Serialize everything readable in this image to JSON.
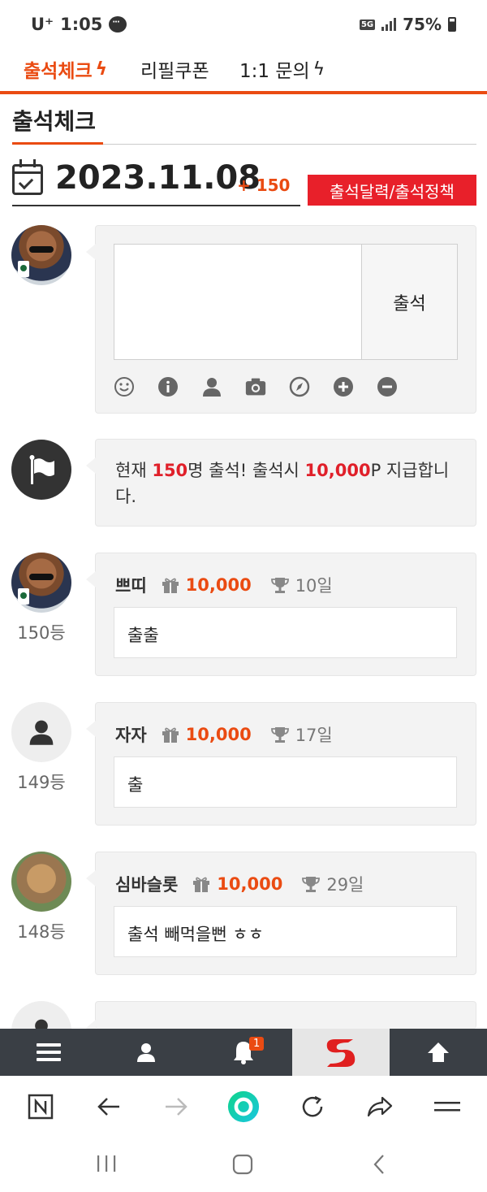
{
  "status": {
    "carrier": "U⁺",
    "time": "1:05",
    "network": "5G",
    "battery": "75%"
  },
  "topnav": {
    "tabs": [
      {
        "label": "출석체크",
        "active": true,
        "bolt": true
      },
      {
        "label": "리필쿠폰",
        "active": false,
        "bolt": false
      },
      {
        "label": "1:1 문의",
        "active": false,
        "bolt": true
      }
    ]
  },
  "page": {
    "title": "출석체크",
    "date": "2023.11.08",
    "date_bonus": "+ 150",
    "policy_button": "출석달력/출석정책"
  },
  "composer": {
    "submit_label": "출석",
    "tools": [
      "smile-icon",
      "info-icon",
      "user-icon",
      "camera-icon",
      "compass-icon",
      "plus-circle-icon",
      "minus-circle-icon"
    ]
  },
  "notice": {
    "prefix": "현재 ",
    "count": "150",
    "middle": "명 출석! 출석시 ",
    "points": "10,000",
    "suffix": "P 지급합니다."
  },
  "entries": [
    {
      "name": "쁘띠",
      "points": "10,000",
      "days": "10일",
      "rank": "150등",
      "message": "출출",
      "avatar": "dog"
    },
    {
      "name": "자자",
      "points": "10,000",
      "days": "17일",
      "rank": "149등",
      "message": "출",
      "avatar": "user"
    },
    {
      "name": "심바슬롯",
      "points": "10,000",
      "days": "29일",
      "rank": "148등",
      "message": "출석 빼먹을뻔 ㅎㅎ",
      "avatar": "cat"
    }
  ],
  "appnav": {
    "notification_count": "1"
  },
  "colors": {
    "accent": "#ea4b12",
    "red": "#e8202a",
    "nav_bg": "#3a3f45",
    "bubble_bg": "#f3f3f3"
  }
}
